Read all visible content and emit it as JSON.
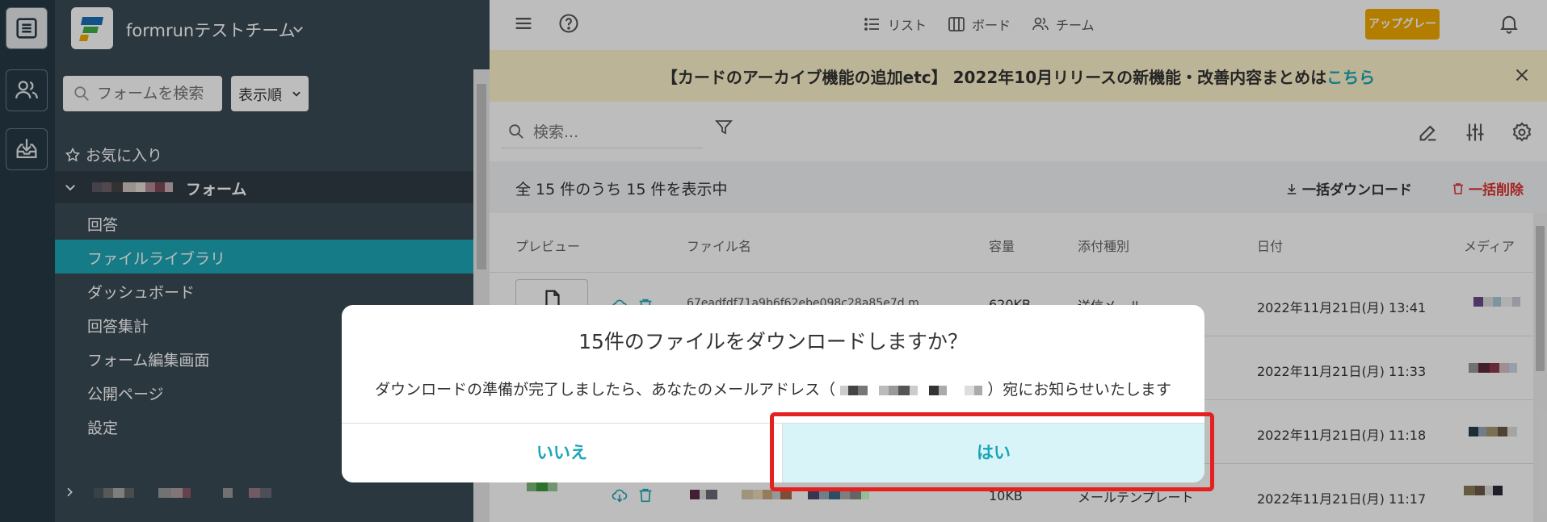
{
  "sidebar": {
    "team_name": "formrunテストチーム",
    "search_placeholder": "フォームを検索",
    "sort_label": "表示順",
    "favorites_label": "お気に入り",
    "form_name_suffix": "フォーム",
    "nav": [
      {
        "label": "回答"
      },
      {
        "label": "ファイルライブラリ"
      },
      {
        "label": "ダッシュボード"
      },
      {
        "label": "回答集計"
      },
      {
        "label": "フォーム編集画面"
      },
      {
        "label": "公開ページ"
      },
      {
        "label": "設定"
      }
    ]
  },
  "header": {
    "views": [
      {
        "label": "リスト",
        "icon": "list-icon"
      },
      {
        "label": "ボード",
        "icon": "board-icon"
      },
      {
        "label": "チーム",
        "icon": "team-icon"
      }
    ],
    "upgrade_label": "アップグレード"
  },
  "banner": {
    "text": "【カードのアーカイブ機能の追加etc】 2022年10月リリースの新機能・改善内容まとめは",
    "link_text": "こちら"
  },
  "files": {
    "search_placeholder": "検索...",
    "count_text": "全 15 件のうち 15 件を表示中",
    "bulk_download_label": "一括ダウンロード",
    "bulk_delete_label": "一括削除",
    "columns": [
      "プレビュー",
      "ファイル名",
      "容量",
      "添付種別",
      "日付",
      "メディア"
    ],
    "rows": [
      {
        "name": "67eadfdf71a9b6f62ebe098c28a85e7d.m",
        "size": "620KB",
        "type": "送信メール",
        "date": "2022年11月21日(月) 13:41"
      },
      {
        "name": "",
        "size": "",
        "type": "",
        "date": "2022年11月21日(月) 11:33"
      },
      {
        "name": "",
        "size": "",
        "type": "",
        "date": "2022年11月21日(月) 11:18"
      },
      {
        "name": "",
        "size": "10KB",
        "type": "メールテンプレート",
        "date": "2022年11月21日(月) 11:17"
      }
    ]
  },
  "modal": {
    "title": "15件のファイルをダウンロードしますか？",
    "message_before": "ダウンロードの準備が完了しましたら、あなたのメールアドレス（",
    "message_after": "）宛にお知らせいたします",
    "no_label": "いいえ",
    "yes_label": "はい"
  },
  "colors": {
    "accent": "#1ba6b7",
    "sidebar_bg": "#3b4b55",
    "rail_bg": "#263b45",
    "upgrade_bg": "#f2a900",
    "banner_bg": "#fdf3cc",
    "highlight": "#e4211e",
    "danger": "#dd3333"
  }
}
